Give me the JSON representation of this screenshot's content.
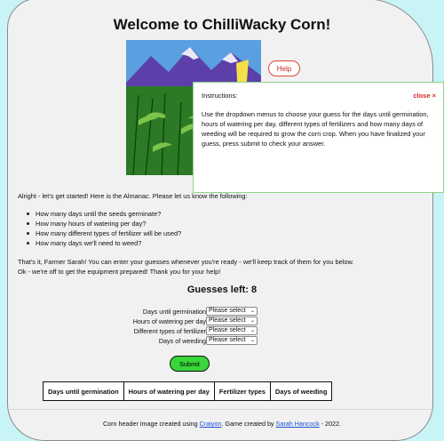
{
  "header": {
    "title": "Welcome to ChilliWacky Corn!"
  },
  "help_button": "Help",
  "instructions": {
    "title": "Instructions:",
    "close_label": "close ×",
    "body": "Use the dropdown menus to choose your guess for the days until germination, hours of watering per day, different types of fertilizers and how many days of weeding will be required to grow the corn crop. When you have finalized your guess, press submit to check your answer."
  },
  "intro": "Alright - let's get started! Here is the Almanac. Please let us know the following:",
  "questions": [
    "How many days until the seeds germinate?",
    "How many hours of watering per day?",
    "How many different types of fertilizer will be used?",
    "How many days we'll need to weed?"
  ],
  "outro_lines": [
    "That's it, Farmer Sarah! You can enter your guesses whenever you're ready - we'll keep track of them for you below.",
    "Ok - we're off to get the equipment prepared! Thank you for your help!"
  ],
  "guesses_left": "Guesses left: 8",
  "form": {
    "fields": [
      {
        "label": "Days until germination",
        "value": "Please select"
      },
      {
        "label": "Hours of watering per day",
        "value": "Please select"
      },
      {
        "label": "Different types of fertilizer",
        "value": "Please select"
      },
      {
        "label": "Days of weeding",
        "value": "Please select"
      }
    ],
    "submit_label": "Submit"
  },
  "table": {
    "headers": [
      "Days until germination",
      "Hours of watering per day",
      "Fertilizer types",
      "Days of weeding"
    ]
  },
  "footer": {
    "text1": "Corn header image created using ",
    "link1": "Craiyon",
    "text2": ". Game created by ",
    "link2": "Sarah Hancock",
    "text3": " - 2022."
  },
  "colors": {
    "page_bg": "#c9f4f6",
    "card_bg": "#f1f1f1",
    "submit_green": "#39d739",
    "close_red": "#d82b1c",
    "link_blue": "#1a55d6"
  },
  "icons": [
    "chevron-down-icon"
  ]
}
